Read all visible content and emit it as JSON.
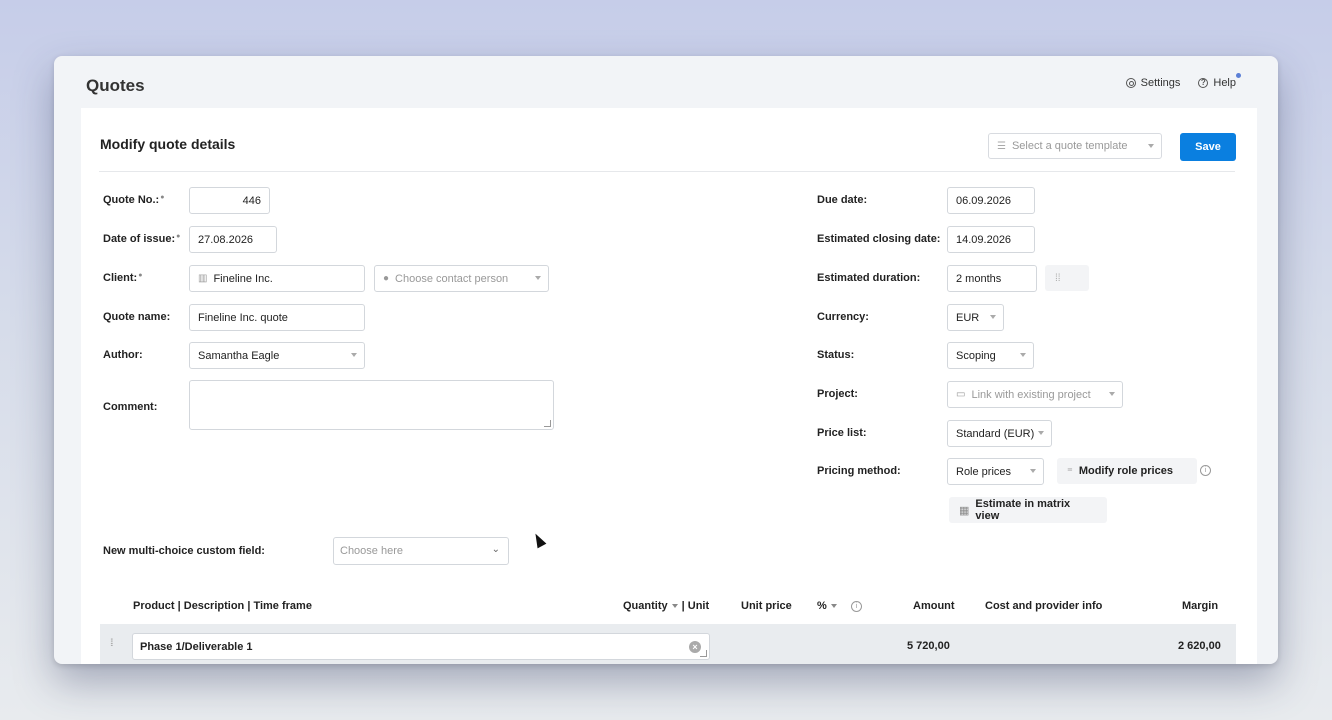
{
  "app": {
    "title": "Quotes",
    "nav": {
      "settings": "Settings",
      "help": "Help"
    }
  },
  "form": {
    "title": "Modify quote details",
    "template_placeholder": "Select a quote template",
    "save_label": "Save",
    "left": {
      "quote_no_label": "Quote No.:",
      "quote_no_value": "446",
      "date_issue_label": "Date of issue:",
      "date_issue_value": "27.08.2026",
      "client_label": "Client:",
      "client_value": "Fineline Inc.",
      "contact_placeholder": "Choose contact person",
      "quote_name_label": "Quote name:",
      "quote_name_value": "Fineline Inc. quote",
      "author_label": "Author:",
      "author_value": "Samantha Eagle",
      "comment_label": "Comment:",
      "comment_value": ""
    },
    "right": {
      "due_date_label": "Due date:",
      "due_date_value": "06.09.2026",
      "closing_date_label": "Estimated closing date:",
      "closing_date_value": "14.09.2026",
      "duration_label": "Estimated duration:",
      "duration_value": "2 months",
      "currency_label": "Currency:",
      "currency_value": "EUR",
      "status_label": "Status:",
      "status_value": "Scoping",
      "project_label": "Project:",
      "project_placeholder": "Link with existing project",
      "price_list_label": "Price list:",
      "price_list_value": "Standard (EUR)",
      "pricing_method_label": "Pricing method:",
      "pricing_method_value": "Role prices",
      "modify_role_prices": "Modify role prices",
      "estimate_matrix": "Estimate in matrix view"
    },
    "custom_field_label": "New multi-choice custom field:",
    "custom_field_placeholder": "Choose here"
  },
  "table": {
    "headers": {
      "product": "Product | Description | Time frame",
      "quantity": "Quantity",
      "unit": "| Unit",
      "unit_price": "Unit price",
      "percent": "%",
      "amount": "Amount",
      "cost": "Cost and provider info",
      "margin": "Margin"
    },
    "rows": [
      {
        "name": "Phase 1/Deliverable 1",
        "amount": "5 720,00",
        "margin": "2 620,00"
      }
    ]
  },
  "colors": {
    "accent": "#0a7fe0"
  }
}
